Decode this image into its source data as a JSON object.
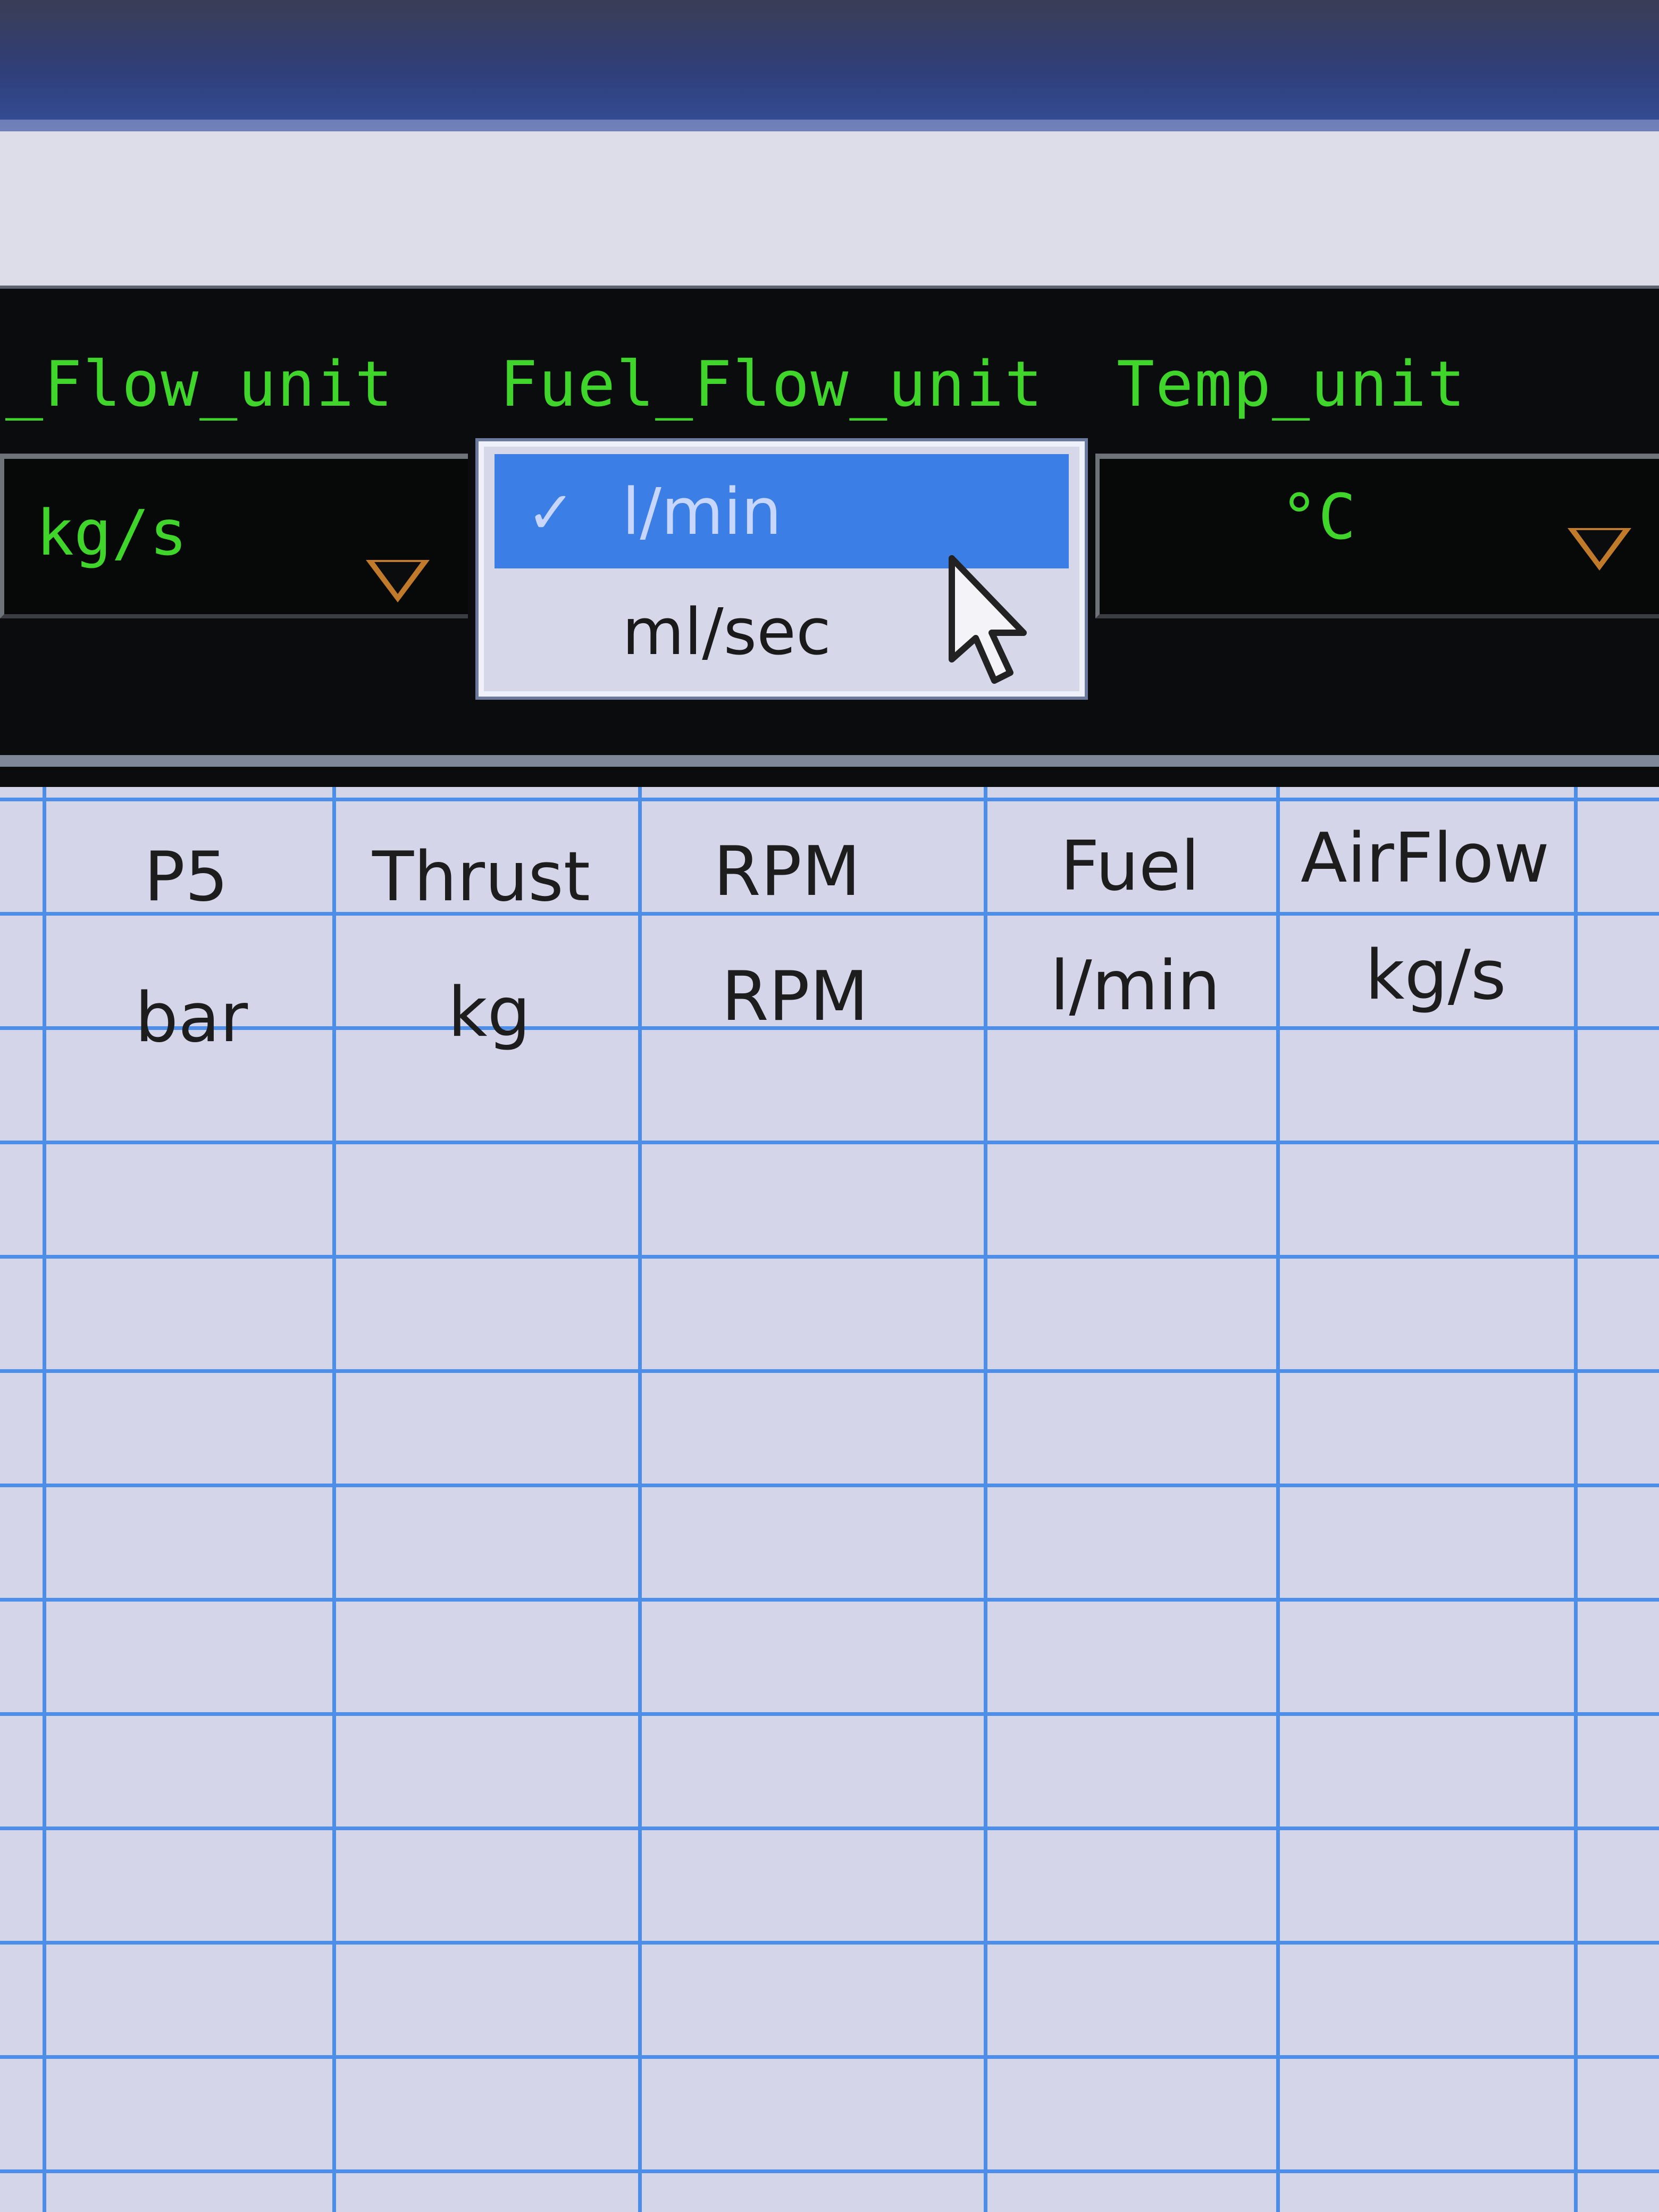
{
  "unit_selectors": [
    {
      "label": "_Flow_unit",
      "value": "kg/s"
    },
    {
      "label": "Fuel_Flow_unit",
      "value": "l/min"
    },
    {
      "label": "Temp_unit",
      "value": "°C"
    }
  ],
  "fuel_flow_dropdown": {
    "options": [
      {
        "label": "l/min",
        "selected": true,
        "check": "✓"
      },
      {
        "label": "ml/sec",
        "selected": false
      }
    ]
  },
  "table": {
    "headers": [
      "P5",
      "Thrust",
      "RPM",
      "Fuel",
      "AirFlow"
    ],
    "units": [
      "bar",
      "kg",
      "RPM",
      "l/min",
      "kg/s"
    ],
    "empty_rows": 10
  },
  "colors": {
    "label_green": "#3fd52a",
    "selection_blue": "#3b7ee6",
    "grid_blue": "#4d8ee8",
    "arrow_orange": "#c07a2a"
  },
  "icons": {
    "dropdown": "dropdown-triangle-icon",
    "check": "checkmark-icon",
    "cursor": "mouse-pointer-icon"
  }
}
